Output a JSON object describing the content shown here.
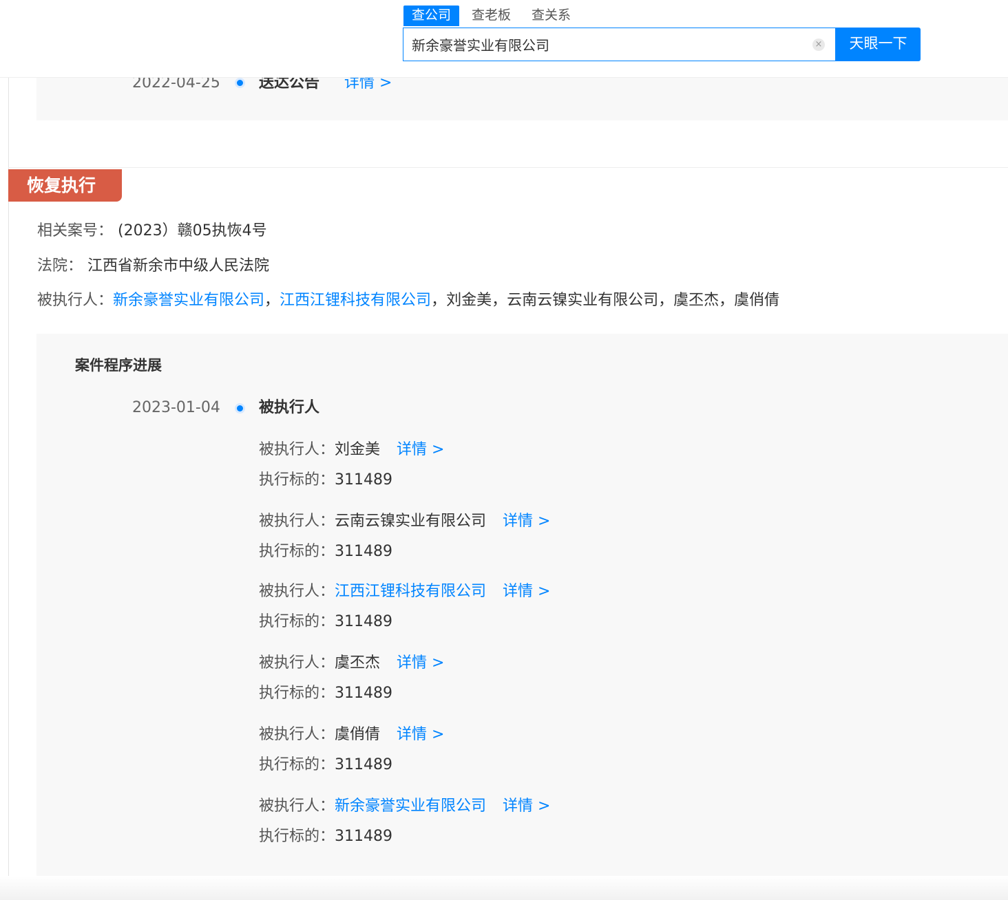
{
  "header": {
    "tabs": [
      {
        "label": "查公司",
        "active": true
      },
      {
        "label": "查老板",
        "active": false
      },
      {
        "label": "查关系",
        "active": false
      }
    ],
    "search_value": "新余豪誉实业有限公司",
    "clear_icon": "×",
    "search_button": "天眼一下"
  },
  "previous_event": {
    "date": "2022-04-25",
    "title": "送达公告",
    "detail": "详情 >"
  },
  "section": {
    "badge": "恢复执行",
    "case_label": "相关案号：",
    "case_value": "(2023）赣05执恢4号",
    "court_label": "法院：",
    "court_value": "江西省新余市中级人民法院",
    "parties_label": "被执行人：",
    "parties": [
      {
        "name": "新余豪誉实业有限公司",
        "sep": "，"
      },
      {
        "name": "江西江锂科技有限公司",
        "sep": "，"
      },
      {
        "name": "刘金美",
        "sep": "，"
      },
      {
        "name": "云南云镍实业有限公司",
        "sep": "，"
      },
      {
        "name": "虞丕杰",
        "sep": "，"
      },
      {
        "name": "虞俏倩",
        "sep": ""
      }
    ]
  },
  "progress": {
    "title": "案件程序进展",
    "date": "2023-01-04",
    "event_title": "被执行人",
    "person_label": "被执行人：",
    "amount_label": "执行标的：",
    "detail": "详情 >",
    "entries": [
      {
        "name": "刘金美",
        "amount": "311489"
      },
      {
        "name": "云南云镍实业有限公司",
        "amount": "311489"
      },
      {
        "name": "江西江锂科技有限公司",
        "amount": "311489"
      },
      {
        "name": "虞丕杰",
        "amount": "311489"
      },
      {
        "name": "虞俏倩",
        "amount": "311489"
      },
      {
        "name": "新余豪誉实业有限公司",
        "amount": "311489"
      }
    ]
  },
  "colors": {
    "accent": "#0084ff",
    "badge": "#d85c45"
  }
}
